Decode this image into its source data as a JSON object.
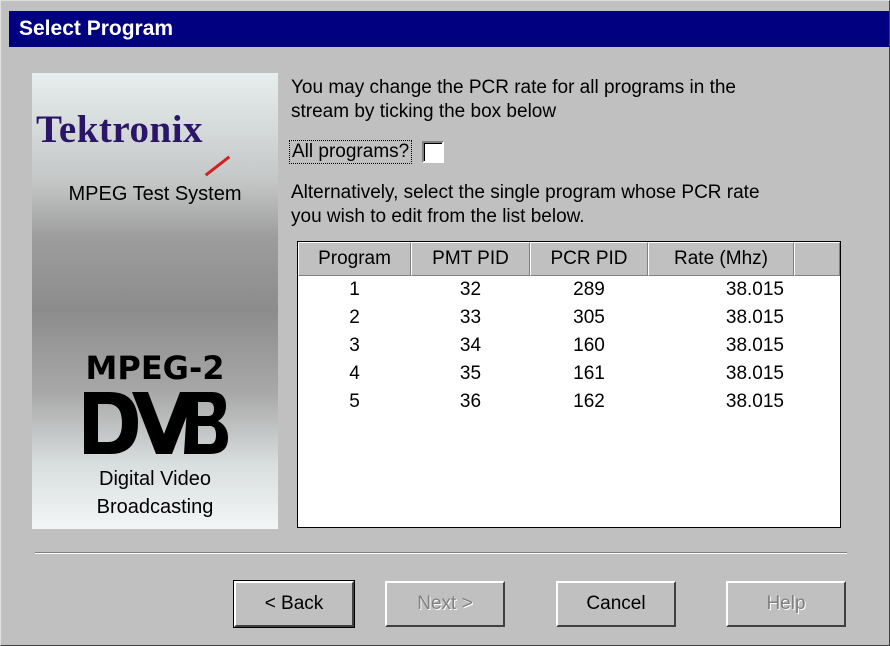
{
  "window": {
    "title": "Select Program"
  },
  "sidebar": {
    "brand": "Tektronix",
    "subtitle": "MPEG Test System",
    "mpeg_label": "MPEG-2",
    "dvb_logo_text": "DVB",
    "caption_line1": "Digital Video",
    "caption_line2": "Broadcasting"
  },
  "content": {
    "intro_line1": "You may change the PCR rate for all programs in the",
    "intro_line2": "stream by ticking the box below",
    "all_programs_label": "All programs?",
    "all_programs_checked": false,
    "alt_line1": "Alternatively, select the single program whose PCR rate",
    "alt_line2": "you wish to edit from the list below."
  },
  "table": {
    "headers": [
      "Program",
      "PMT PID",
      "PCR PID",
      "Rate (Mhz)"
    ],
    "rows": [
      [
        "1",
        "32",
        "289",
        "38.015"
      ],
      [
        "2",
        "33",
        "305",
        "38.015"
      ],
      [
        "3",
        "34",
        "160",
        "38.015"
      ],
      [
        "4",
        "35",
        "161",
        "38.015"
      ],
      [
        "5",
        "36",
        "162",
        "38.015"
      ]
    ]
  },
  "buttons": {
    "back": "< Back",
    "next": "Next >",
    "cancel": "Cancel",
    "help": "Help"
  }
}
